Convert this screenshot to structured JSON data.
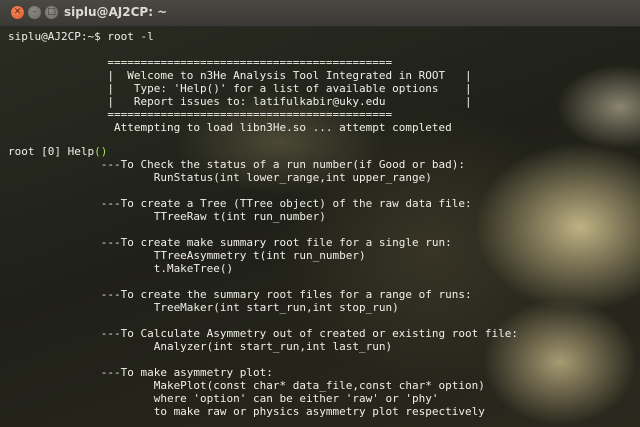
{
  "window": {
    "title": "siplu@AJ2CP: ~"
  },
  "terminal": {
    "lines": [
      "siplu@AJ2CP:~$ root -l",
      "",
      "               ===========================================",
      "               |  Welcome to n3He Analysis Tool Integrated in ROOT   |",
      "               |   Type: 'Help()' for a list of available options    |",
      "               |   Report issues to: latifulkabir@uky.edu            |",
      "               ===========================================",
      "                Attempting to load libn3He.so ... attempt completed",
      "",
      "root [0] Help",
      "              ---To Check the status of a run number(if Good or bad):",
      "                      RunStatus(int lower_range,int upper_range)",
      "",
      "              ---To create a Tree (TTree object) of the raw data file:",
      "                      TTreeRaw t(int run_number)",
      "",
      "              ---To create make summary root file for a single run:",
      "                      TTreeAsymmetry t(int run_number)",
      "                      t.MakeTree()",
      "",
      "              ---To create the summary root files for a range of runs:",
      "                      TreeMaker(int start_run,int stop_run)",
      "",
      "              ---To Calculate Asymmetry out of created or existing root file:",
      "                      Analyzer(int start_run,int last_run)",
      "",
      "              ---To make asymmetry plot:",
      "                      MakePlot(const char* data_file,const char* option)",
      "                      where 'option' can be either 'raw' or 'phy'",
      "                      to make raw or physics asymmetry plot respectively"
    ],
    "help_parens": "()"
  },
  "colors": {
    "text": "#f0efe9",
    "paren_highlight": "#9be35a",
    "titlebar": "#3e3d39"
  }
}
